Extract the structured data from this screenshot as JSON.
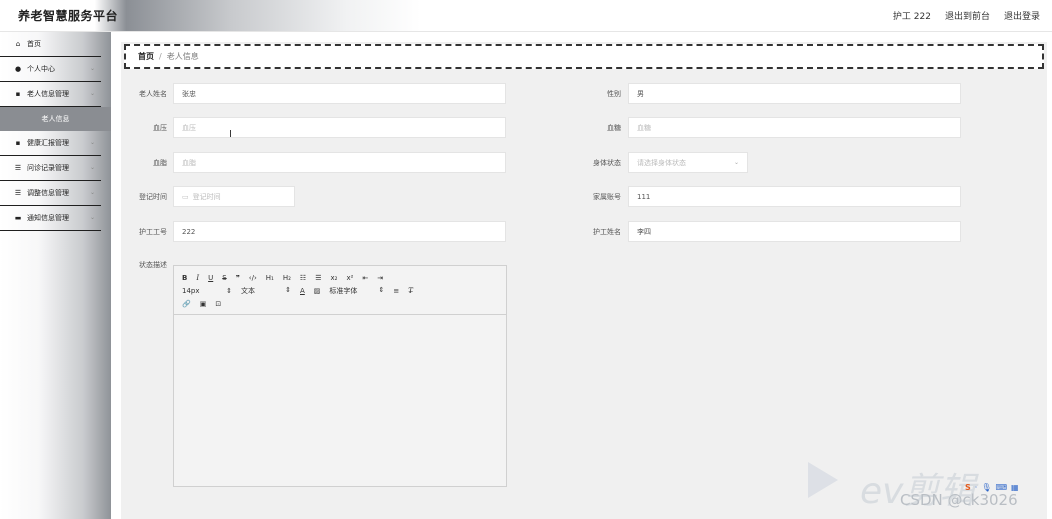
{
  "header": {
    "brand": "养老智慧服务平台",
    "user": "护工 222",
    "exit_front": "退出到前台",
    "logout": "退出登录"
  },
  "sidebar": {
    "items": [
      {
        "label": "首页",
        "icon": "home-icon",
        "glyph": "⌂"
      },
      {
        "label": "个人中心",
        "icon": "user-icon",
        "glyph": "●",
        "chevron": "⌄"
      },
      {
        "label": "老人信息管理",
        "icon": "grid-icon",
        "glyph": "▪",
        "chevron": "⌄"
      },
      {
        "label": "老人信息",
        "sub": true
      },
      {
        "label": "健康汇报管理",
        "icon": "grid-icon",
        "glyph": "▪",
        "chevron": "⌄"
      },
      {
        "label": "问诊记录管理",
        "icon": "list-icon",
        "glyph": "☰",
        "chevron": "⌄"
      },
      {
        "label": "调整信息管理",
        "icon": "list-icon",
        "glyph": "☰",
        "chevron": "⌄"
      },
      {
        "label": "通知信息管理",
        "icon": "chat-icon",
        "glyph": "▬",
        "chevron": "⌄"
      }
    ]
  },
  "breadcrumb": {
    "home": "首页",
    "separator": "/",
    "current": "老人信息"
  },
  "form": {
    "name": {
      "label": "老人姓名",
      "value": "张忠"
    },
    "gender": {
      "label": "性别",
      "value": "男"
    },
    "blood_pressure": {
      "label": "血压",
      "placeholder": "血压"
    },
    "blood_sugar": {
      "label": "血糖",
      "placeholder": "血糖"
    },
    "blood_lipid": {
      "label": "血脂",
      "placeholder": "血脂"
    },
    "body_status": {
      "label": "身体状态",
      "placeholder": "请选择身体状态"
    },
    "register_time": {
      "label": "登记时间",
      "placeholder": "登记时间"
    },
    "family_account": {
      "label": "家属账号",
      "value": "111"
    },
    "nurse_id": {
      "label": "护工工号",
      "value": "222"
    },
    "nurse_name": {
      "label": "护工姓名",
      "value": "李四"
    },
    "status_desc": {
      "label": "状态描述"
    }
  },
  "editor": {
    "font_size": "14px",
    "text_type": "文本",
    "font_family": "标准字体"
  },
  "watermark": {
    "ev": "ev剪辑",
    "csdn": "CSDN @ck3026"
  }
}
